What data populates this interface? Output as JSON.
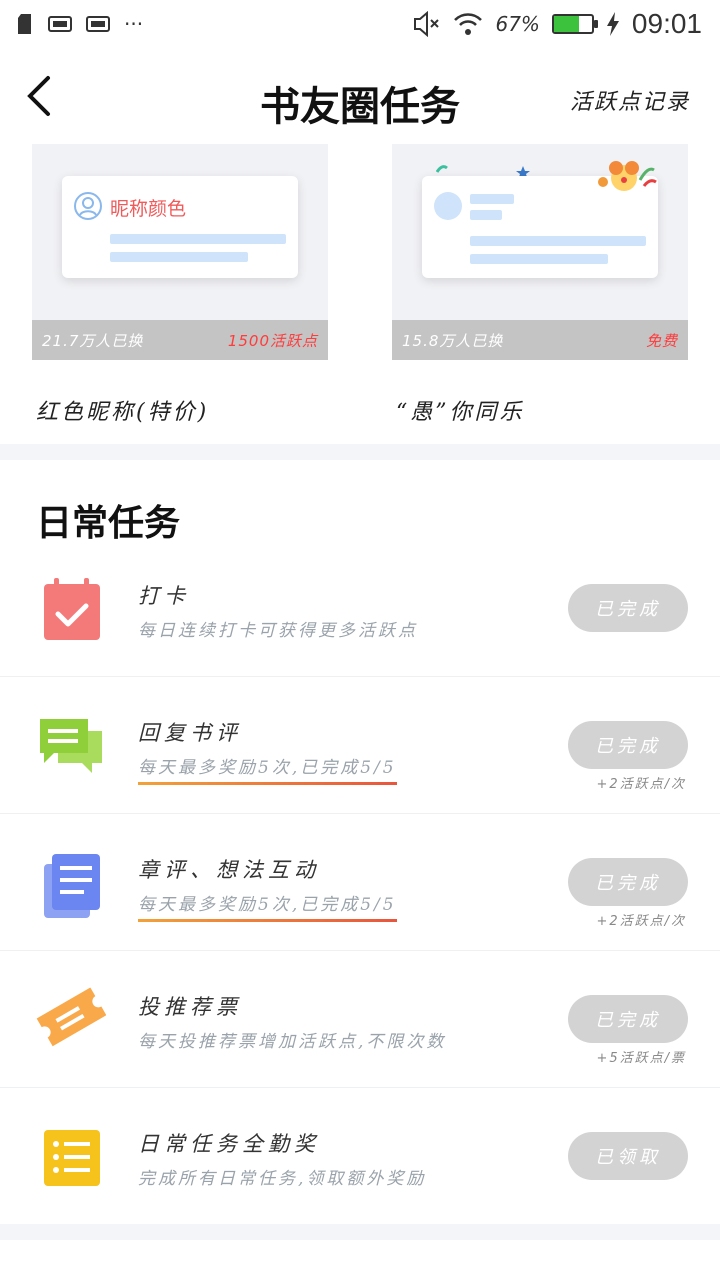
{
  "status": {
    "battery_pct": "67%",
    "time": "09:01"
  },
  "header": {
    "title": "书友圈任务",
    "link": "活跃点记录"
  },
  "cards": [
    {
      "preview_text": "昵称颜色",
      "exchanged": "21.7万人已换",
      "price": "1500活跃点",
      "name": "红色昵称(特价)"
    },
    {
      "exchanged": "15.8万人已换",
      "price": "免费",
      "name": "“愚”你同乐"
    }
  ],
  "section_title": "日常任务",
  "tasks": [
    {
      "title": "打卡",
      "desc": "每日连续打卡可获得更多活跃点",
      "button": "已完成",
      "note": ""
    },
    {
      "title": "回复书评",
      "desc": "每天最多奖励5次,已完成5/5",
      "button": "已完成",
      "note": "+2活跃点/次"
    },
    {
      "title": "章评、想法互动",
      "desc": "每天最多奖励5次,已完成5/5",
      "button": "已完成",
      "note": "+2活跃点/次"
    },
    {
      "title": "投推荐票",
      "desc": "每天投推荐票增加活跃点,不限次数",
      "button": "已完成",
      "note": "+5活跃点/票"
    },
    {
      "title": "日常任务全勤奖",
      "desc": "完成所有日常任务,领取额外奖励",
      "button": "已领取",
      "note": ""
    }
  ],
  "colors": {
    "checkin": "#f47a7a",
    "reply": "#8fcf3a",
    "chapter": "#6b86f0",
    "ticket": "#f9a94a",
    "attendance": "#f6c21c",
    "button_done": "#d3d3d3"
  }
}
